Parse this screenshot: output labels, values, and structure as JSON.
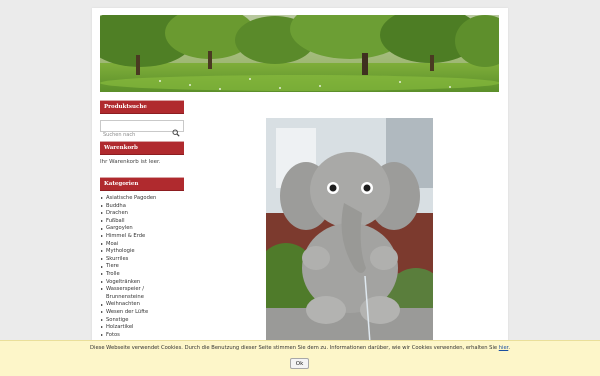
{
  "sidebar": {
    "search_widget": {
      "title": "Produktsuche",
      "placeholder": "Suchen nach",
      "icon": "search-icon"
    },
    "cart_widget": {
      "title": "Warenkorb",
      "text": "Ihr Warenkorb ist leer."
    },
    "categories_widget": {
      "title": "Kategorien",
      "items": [
        "Asiatische Pagoden",
        "Buddha",
        "Drachen",
        "Fußball",
        "Gargoylen",
        "Himmel & Erde",
        "Moai",
        "Mythologie",
        "Skurriles",
        "Tiere",
        "Trolle",
        "Vogeltränken",
        "Wasserspeier /",
        "Brunnensteine",
        "Weihnachten",
        "Wesen der Lüfte",
        "Sonstige",
        "Holzartikel",
        "Fotos"
      ]
    }
  },
  "cookie": {
    "text": "Diese Webseite verwendet Cookies. Durch die Benutzung dieser Seite stimmen Sie dem zu. Informationen darüber, wie wir Cookies verwenden, erhalten Sie",
    "link": "hier",
    "suffix": ".",
    "ok_label": "Ok"
  },
  "colors": {
    "accent": "#b02a2e",
    "cookie_bg": "#fdf6c9",
    "page_bg": "#ebebeb"
  }
}
